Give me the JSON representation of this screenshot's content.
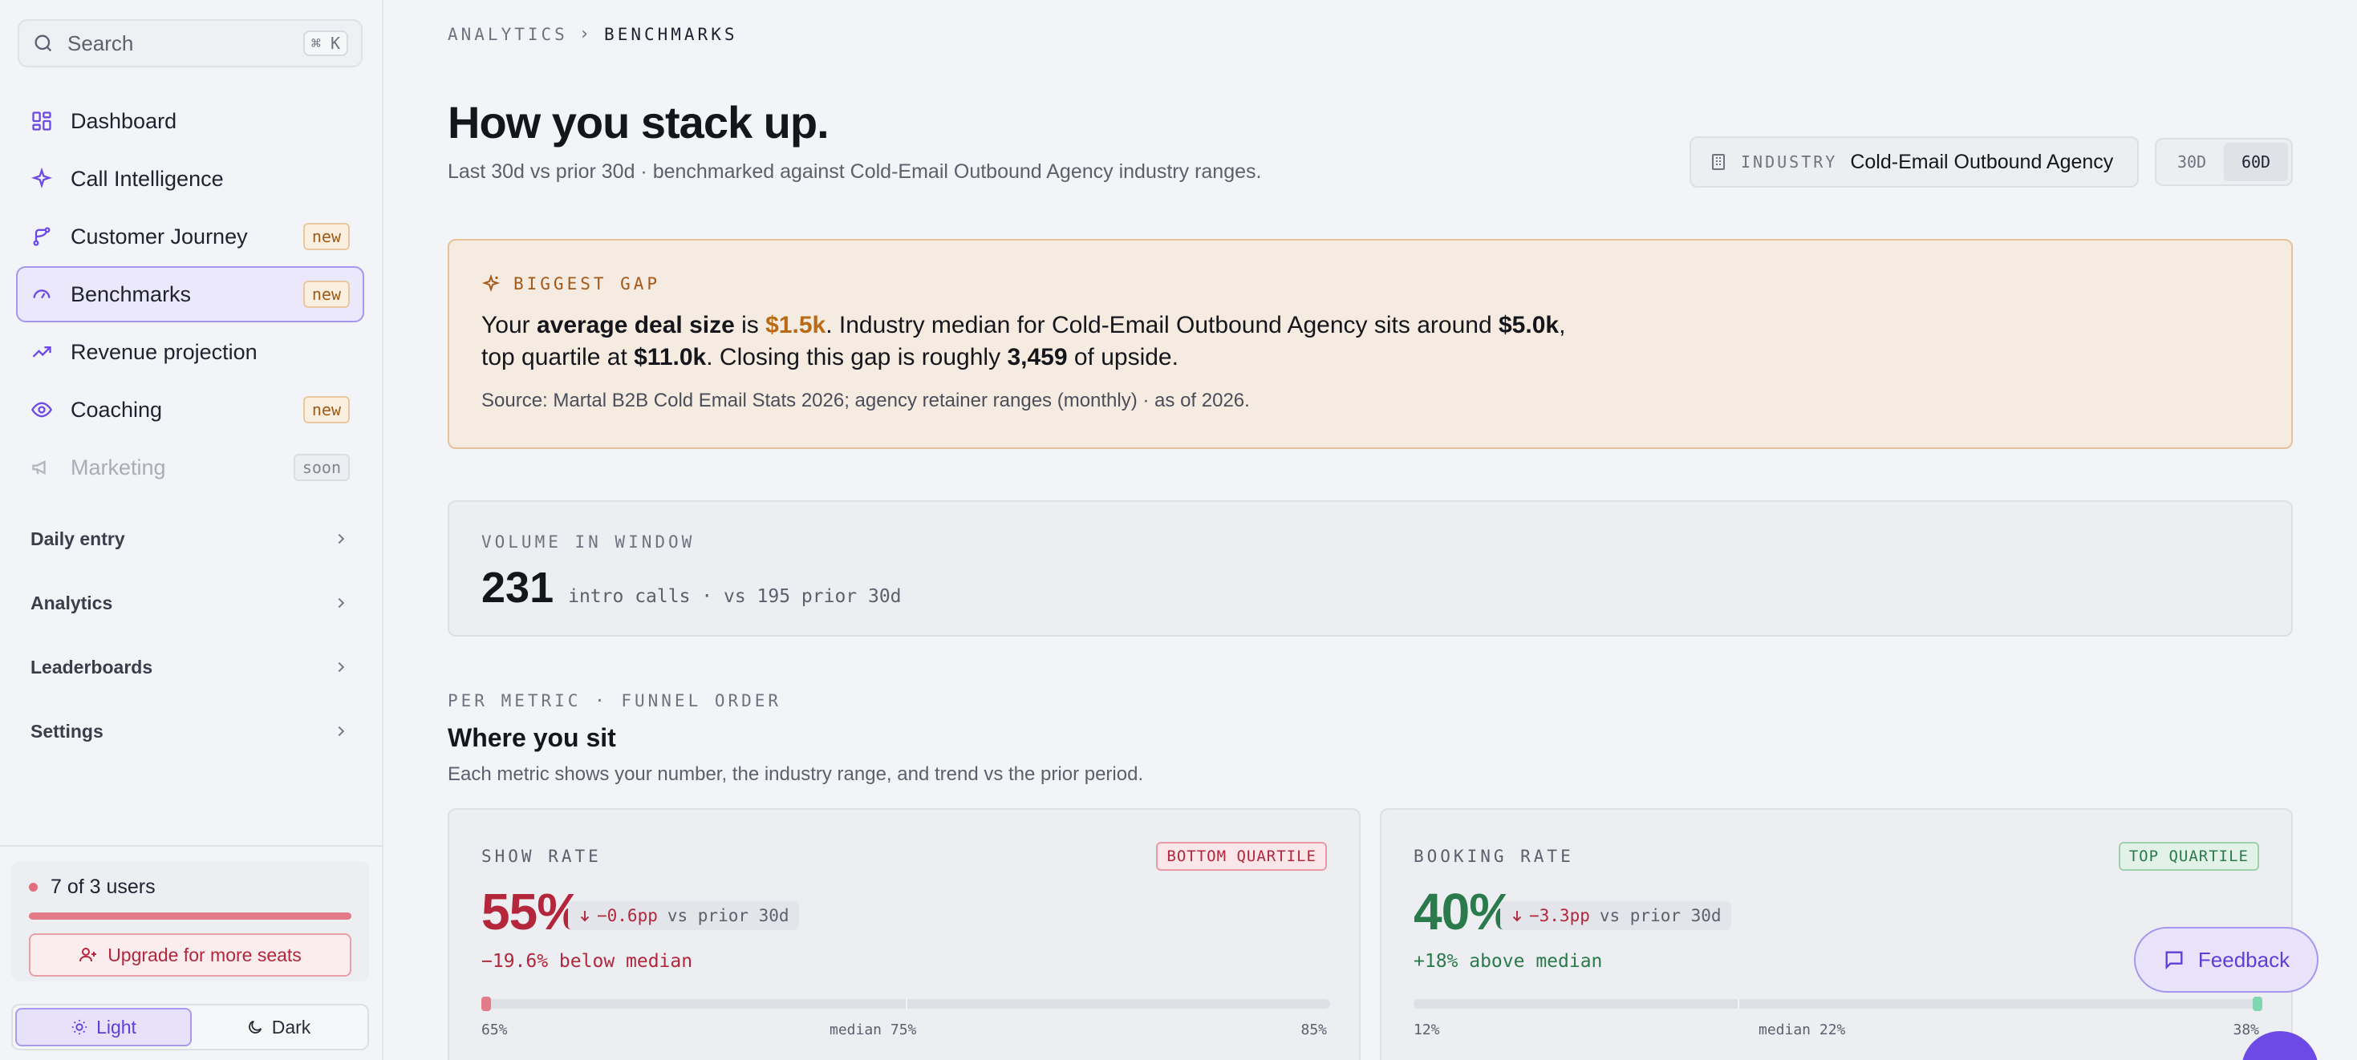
{
  "search": {
    "placeholder": "Search",
    "shortcut": "⌘ K"
  },
  "nav": {
    "items": [
      {
        "label": "Dashboard",
        "icon": "dashboard-icon"
      },
      {
        "label": "Call Intelligence",
        "icon": "sparkle-icon"
      },
      {
        "label": "Customer Journey",
        "icon": "branch-icon",
        "badge": "new"
      },
      {
        "label": "Benchmarks",
        "icon": "gauge-icon",
        "badge": "new",
        "active": true
      },
      {
        "label": "Revenue projection",
        "icon": "trending-up-icon"
      },
      {
        "label": "Coaching",
        "icon": "eye-icon",
        "badge": "new"
      },
      {
        "label": "Marketing",
        "icon": "megaphone-icon",
        "badge": "soon",
        "disabled": true
      }
    ],
    "groups": [
      "Daily entry",
      "Analytics",
      "Leaderboards",
      "Settings"
    ]
  },
  "seats": {
    "text": "7 of 3 users",
    "upgrade_label": "Upgrade for more seats"
  },
  "theme": {
    "light": "Light",
    "dark": "Dark",
    "selected": "light"
  },
  "breadcrumb": {
    "parent": "ANALYTICS",
    "current": "BENCHMARKS"
  },
  "header": {
    "title": "How you stack up.",
    "subtitle": "Last 30d vs prior 30d · benchmarked against Cold-Email Outbound Agency industry ranges."
  },
  "industry": {
    "key": "INDUSTRY",
    "value": "Cold-Email Outbound Agency"
  },
  "range": {
    "options": [
      "30D",
      "60D"
    ],
    "selected": "60D"
  },
  "gap": {
    "tag": "BIGGEST GAP",
    "p1": "Your ",
    "metric": "average deal size",
    "p2": " is ",
    "yours": "$1.5k",
    "p3": ". Industry median for Cold-Email Outbound Agency sits around ",
    "median": "$5.0k",
    "p4": ", top quartile at ",
    "top": "$11.0k",
    "p5": ". Closing this gap is roughly ",
    "upside": "3,459",
    "p6": " of upside.",
    "source": "Source: Martal B2B Cold Email Stats 2026; agency retainer ranges (monthly) · as of 2026."
  },
  "volume": {
    "label": "VOLUME IN WINDOW",
    "value": "231",
    "detail": "intro calls · vs 195 prior 30d"
  },
  "section": {
    "kicker": "PER METRIC · FUNNEL ORDER",
    "title": "Where you sit",
    "subtitle": "Each metric shows your number, the industry range, and trend vs the prior period."
  },
  "metrics": [
    {
      "name": "SHOW RATE",
      "quartile": "BOTTOM QUARTILE",
      "value": "55%",
      "delta": "−0.6pp",
      "delta_suffix": "vs prior 30d",
      "relative": "−19.6% below median",
      "range_low": "65%",
      "range_median": "median 75%",
      "range_high": "85%",
      "position": 0.0,
      "color": "#b3263b"
    },
    {
      "name": "BOOKING RATE",
      "quartile": "TOP QUARTILE",
      "value": "40%",
      "delta": "−3.3pp",
      "delta_suffix": "vs prior 30d",
      "relative": "+18% above median",
      "range_low": "12%",
      "range_median": "median 22%",
      "range_high": "38%",
      "position": 1.0,
      "color": "#2b7a4b"
    }
  ],
  "feedback": {
    "label": "Feedback"
  }
}
